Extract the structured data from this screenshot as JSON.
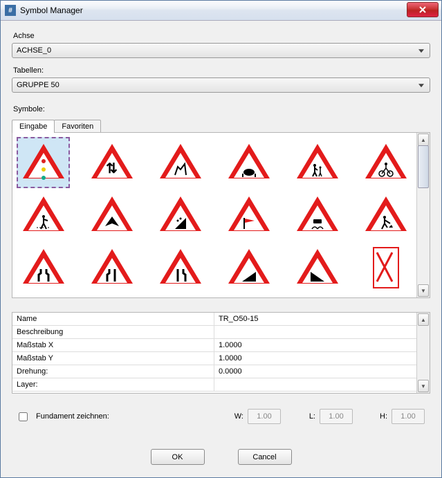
{
  "window": {
    "title": "Symbol Manager"
  },
  "labels": {
    "achse": "Achse",
    "tabellen": "Tabellen:",
    "symbole": "Symbole:"
  },
  "achse": {
    "selected": "ACHSE_0"
  },
  "tabellen": {
    "selected": "GRUPPE 50"
  },
  "tabs": {
    "eingabe": "Eingabe",
    "favoriten": "Favoriten"
  },
  "symbols": [
    {
      "id": "traffic-light",
      "glyph": "dots"
    },
    {
      "id": "two-way",
      "glyph": "↑↓"
    },
    {
      "id": "deer",
      "glyph": "deer"
    },
    {
      "id": "cattle",
      "glyph": "cow"
    },
    {
      "id": "pedestrians",
      "glyph": "peds"
    },
    {
      "id": "cyclist",
      "glyph": "bike"
    },
    {
      "id": "crosswalk",
      "glyph": "cross"
    },
    {
      "id": "aircraft",
      "glyph": "plane"
    },
    {
      "id": "falling-rocks",
      "glyph": "rocks"
    },
    {
      "id": "wind",
      "glyph": "wind"
    },
    {
      "id": "skid",
      "glyph": "skid"
    },
    {
      "id": "roadworks",
      "glyph": "dig"
    },
    {
      "id": "narrow-both",
      "glyph": "nb"
    },
    {
      "id": "narrow-left",
      "glyph": "nl"
    },
    {
      "id": "narrow-right",
      "glyph": "nr"
    },
    {
      "id": "steep-up",
      "glyph": "up"
    },
    {
      "id": "steep-down",
      "glyph": "down"
    },
    {
      "id": "crossing-x",
      "glyph": "xsign"
    }
  ],
  "props": {
    "rows": [
      {
        "label": "Name",
        "value": "TR_O50-15"
      },
      {
        "label": "Beschreibung",
        "value": ""
      },
      {
        "label": "Maßstab X",
        "value": "1.0000"
      },
      {
        "label": "Maßstab Y",
        "value": "1.0000"
      },
      {
        "label": "Drehung:",
        "value": "0.0000"
      },
      {
        "label": "Layer:",
        "value": ""
      }
    ]
  },
  "foundation": {
    "label": "Fundament zeichnen:",
    "w_label": "W:",
    "w_value": "1.00",
    "l_label": "L:",
    "l_value": "1.00",
    "h_label": "H:",
    "h_value": "1.00"
  },
  "buttons": {
    "ok": "OK",
    "cancel": "Cancel"
  }
}
